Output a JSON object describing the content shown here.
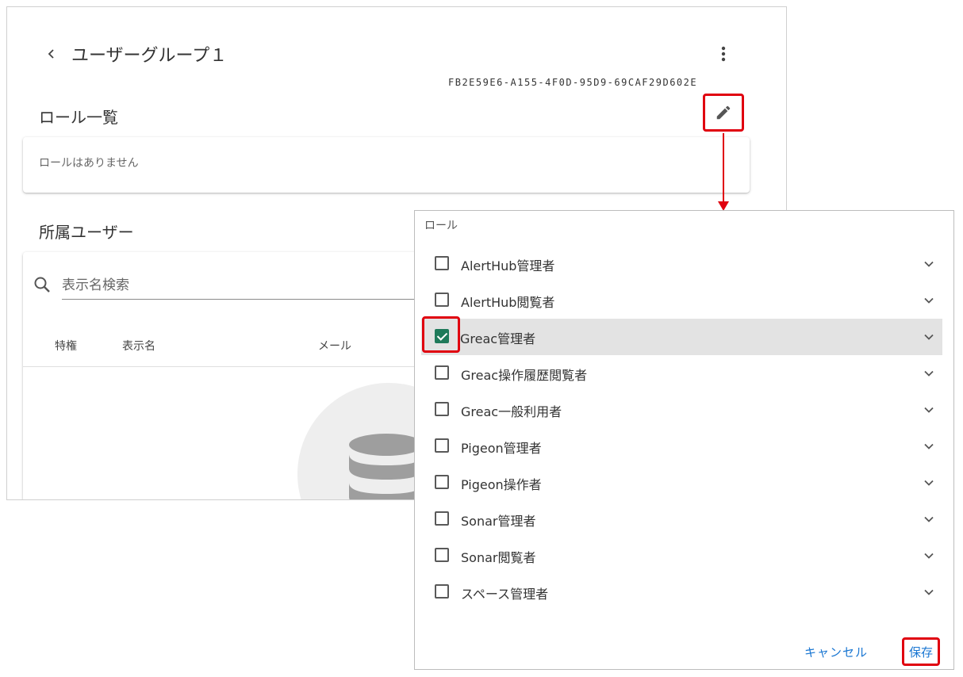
{
  "header": {
    "title": "ユーザーグループ１",
    "group_id": "FB2E59E6-A155-4F0D-95D9-69CAF29D602E"
  },
  "roles_section": {
    "title": "ロール一覧",
    "empty_text": "ロールはありません"
  },
  "members_section": {
    "title": "所属ユーザー",
    "search_placeholder": "表示名検索",
    "columns": [
      "特権",
      "表示名",
      "メール"
    ]
  },
  "role_dialog": {
    "label": "ロール",
    "items": [
      {
        "label": "AlertHub管理者",
        "checked": false
      },
      {
        "label": "AlertHub閲覧者",
        "checked": false
      },
      {
        "label": "Greac管理者",
        "checked": true
      },
      {
        "label": "Greac操作履歴閲覧者",
        "checked": false
      },
      {
        "label": "Greac一般利用者",
        "checked": false
      },
      {
        "label": "Pigeon管理者",
        "checked": false
      },
      {
        "label": "Pigeon操作者",
        "checked": false
      },
      {
        "label": "Sonar管理者",
        "checked": false
      },
      {
        "label": "Sonar閲覧者",
        "checked": false
      },
      {
        "label": "スペース管理者",
        "checked": false
      }
    ],
    "cancel_label": "キャンセル",
    "save_label": "保存"
  },
  "colors": {
    "highlight": "#e0000f",
    "accent": "#1976d2",
    "checkbox_checked": "#1f7a5a"
  },
  "icons": [
    "chevron-left-icon",
    "more-vert-icon",
    "pencil-icon",
    "search-icon",
    "database-icon",
    "chevron-down-icon"
  ]
}
